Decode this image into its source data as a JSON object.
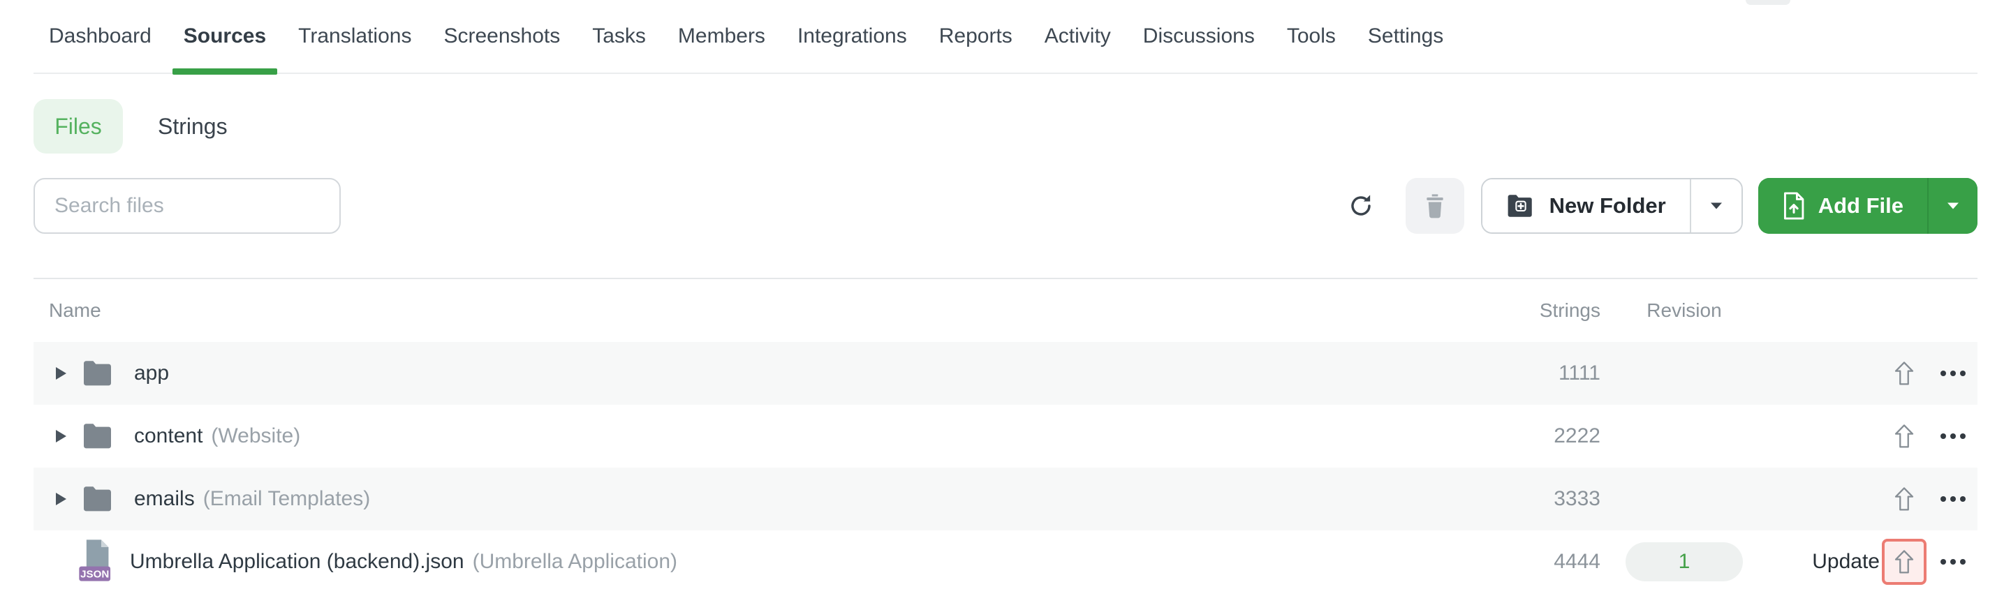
{
  "nav": {
    "items": [
      {
        "label": "Dashboard",
        "active": false
      },
      {
        "label": "Sources",
        "active": true
      },
      {
        "label": "Translations",
        "active": false
      },
      {
        "label": "Screenshots",
        "active": false
      },
      {
        "label": "Tasks",
        "active": false
      },
      {
        "label": "Members",
        "active": false
      },
      {
        "label": "Integrations",
        "active": false
      },
      {
        "label": "Reports",
        "active": false
      },
      {
        "label": "Activity",
        "active": false
      },
      {
        "label": "Discussions",
        "active": false
      },
      {
        "label": "Tools",
        "active": false
      },
      {
        "label": "Settings",
        "active": false
      }
    ]
  },
  "tabs": [
    {
      "label": "Files",
      "active": true
    },
    {
      "label": "Strings",
      "active": false
    }
  ],
  "toolbar": {
    "search_placeholder": "Search files",
    "new_folder_label": "New Folder",
    "add_file_label": "Add File"
  },
  "table": {
    "header": {
      "name": "Name",
      "strings": "Strings",
      "revision": "Revision"
    },
    "rows": [
      {
        "kind": "folder",
        "name": "app",
        "note": "",
        "strings": "1111"
      },
      {
        "kind": "folder",
        "name": "content",
        "note": "(Website)",
        "strings": "2222"
      },
      {
        "kind": "folder",
        "name": "emails",
        "note": "(Email Templates)",
        "strings": "3333"
      },
      {
        "kind": "file",
        "name": "Umbrella Application (backend).json",
        "note": "(Umbrella Application)",
        "strings": "4444",
        "revision": "1",
        "update_label": "Update",
        "badge": "JSON",
        "upload_highlighted": true
      }
    ]
  },
  "colors": {
    "accent_green": "#38a047",
    "files_tab_bg": "#e9f5eb",
    "files_tab_text": "#55b25f",
    "row_stripe": "#f7f8f8",
    "revision_text": "#43a047",
    "highlight_border": "#ec7c73",
    "highlight_bg": "#fdeeed",
    "json_badge": "#9473ae"
  }
}
